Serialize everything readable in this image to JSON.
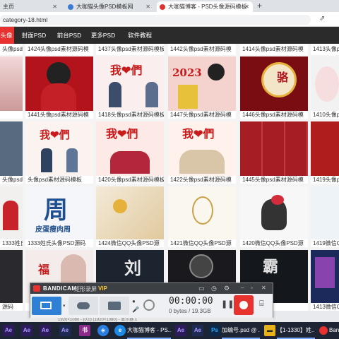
{
  "browser": {
    "tabs": [
      {
        "label": "主页"
      },
      {
        "label": "大咖猫头像PSD模板网"
      },
      {
        "label": "大咖猫博客 - PSD头像源码模板"
      }
    ],
    "new_tab": "+",
    "url": "category-18.html"
  },
  "site_nav": {
    "items": [
      {
        "label": "头像PSD",
        "active": true
      },
      {
        "label": "封面PSD"
      },
      {
        "label": "前台PSD"
      },
      {
        "label": "更多PSD"
      },
      {
        "label": "软件教程"
      }
    ]
  },
  "grid": {
    "rows": [
      {
        "captions": [
          "头像psd素材源码模板",
          "1424头像psd素材源码模",
          "1437头像psd素材源码模板",
          "1442头像psd素材源码模",
          "1414头像psd素材源码模",
          "1413头像psd素材源码模"
        ]
      },
      {
        "captions": [
          "",
          "1441头像psd素材源码模",
          "1418头像psd素材源码模板",
          "1447头像psd素材源码模",
          "1446头像psd素材源码模",
          "1410头像psd素材源码模"
        ],
        "texts": [
          "",
          "",
          "我❤們",
          "2023",
          "骆",
          ""
        ]
      },
      {
        "captions": [
          "头像psd素材源码模板",
          "头像psd素材源码模板",
          "1420头像psd素材源码模板",
          "1422头像psd素材源码模",
          "1445头像psd素材源码模",
          "1419头像psd素材源码"
        ],
        "texts": [
          "",
          "我❤們",
          "我❤們",
          "我❤們",
          "",
          ""
        ]
      },
      {
        "captions": [
          "1333姓氏头像PSD源码",
          "1333姓氏头像PSD源码",
          "1424微信QQ头像PSD源",
          "1421微信QQ头像PSD源",
          "1420微信QQ头像PSD源",
          "1419微信QQ头像PSD源"
        ],
        "texts": [
          "",
          "周",
          "",
          "",
          "",
          ""
        ],
        "subtexts": [
          "",
          "皮蛋瘦肉周",
          "",
          "",
          "",
          ""
        ]
      },
      {
        "captions": [
          "源码",
          "",
          "",
          "",
          "",
          "1413微信QQ头像PSD源"
        ],
        "texts": [
          "",
          "福",
          "刘",
          "",
          "霸",
          ""
        ]
      }
    ]
  },
  "bandicam": {
    "brand": "BANDICAM",
    "mode_label": "矩形录屏",
    "vip": "VIP",
    "timer": "00:00:00",
    "size": "0 bytes / 19.3GB",
    "sub_info": "1920×1080 - (0,0) (1920×1080) - 显示器 1"
  },
  "taskbar": {
    "items": [
      {
        "label": "大咖猫博客 - PS..."
      },
      {
        "label": "加编号.psd @ ..."
      },
      {
        "label": "【1-1330】姓..."
      },
      {
        "label": "Ban"
      }
    ]
  },
  "colors": {
    "nav_bg": "#2b2b2b",
    "nav_active": "#e8322f",
    "bandicam_title": "#3c3f44",
    "record_red": "#e8322f"
  }
}
